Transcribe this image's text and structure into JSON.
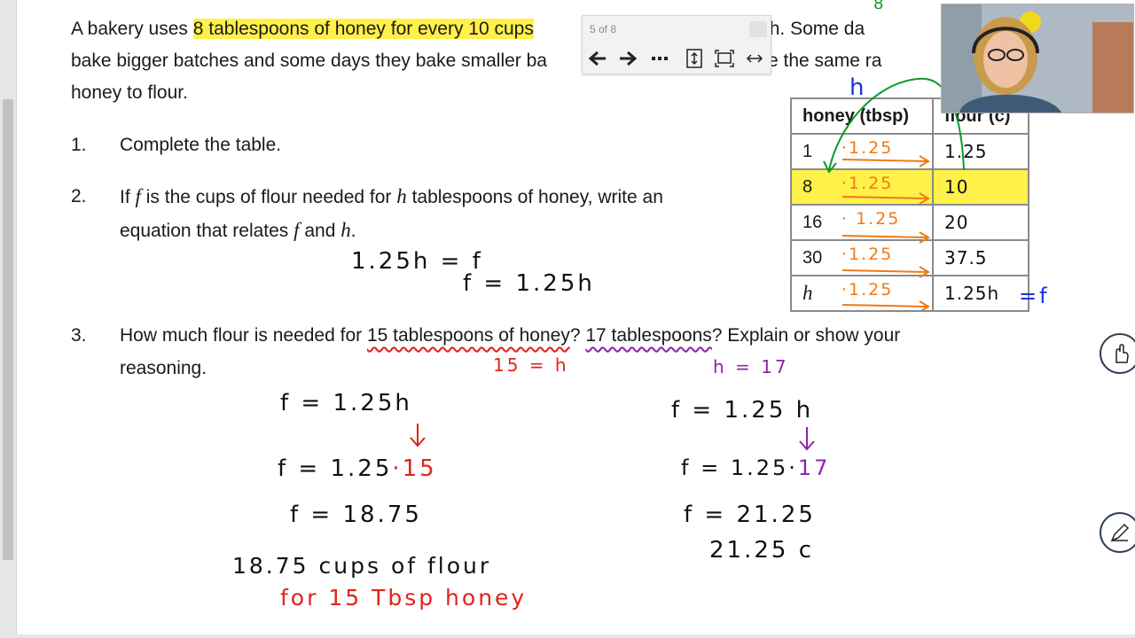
{
  "problem": {
    "intro_line1_pre": "A bakery uses ",
    "intro_line1_hl": "8 tablespoons of honey for every 10 cups",
    "intro_line1_post": "ad dough. Some da",
    "intro_line2_pre": "bake bigger batches and some days they bake smaller ba",
    "intro_line2_post": "ys use the same ra",
    "intro_line3": "honey to flour."
  },
  "questions": [
    {
      "num": "1.",
      "text": "Complete the table."
    },
    {
      "num": "2.",
      "line1_a": "If ",
      "line1_f": "f",
      "line1_b": " is the cups of flour needed for ",
      "line1_h": "h",
      "line1_c": " tablespoons of honey, write an",
      "line2_a": "equation that relates ",
      "line2_f": "f",
      "line2_b": " and ",
      "line2_h": "h",
      "line2_c": "."
    },
    {
      "num": "3.",
      "a": "How much flour is needed for ",
      "u1": "15 tablespoons of honey",
      "b": "? ",
      "u2": "17 tablespoons",
      "c": "? Explain or show your",
      "line2": "reasoning."
    }
  ],
  "table": {
    "header": [
      "honey (tbsp)",
      "flour (c)"
    ],
    "rows": [
      {
        "honey": "1",
        "mult": "·1.25",
        "flour": "1.25",
        "highlight": false
      },
      {
        "honey": "8",
        "mult": "·1.25",
        "flour": "10",
        "highlight": true
      },
      {
        "honey": "16",
        "mult": "· 1.25",
        "flour": "20",
        "highlight": false
      },
      {
        "honey": "30",
        "mult": "·1.25",
        "flour": "37.5",
        "highlight": false
      },
      {
        "honey": "h",
        "mult": "·1.25",
        "flour": "1.25h",
        "highlight": false
      }
    ],
    "flour_suffix": "=f",
    "h_annotation": "h",
    "top_annotation": "8"
  },
  "handwriting": {
    "q2_eq1": "1.25h = f",
    "q2_eq2": "f = 1.25h",
    "q3_left_label": "15 = h",
    "q3_right_label": "h = 17",
    "left_eq1": "f = 1.25h",
    "left_eq2_a": "f = 1.25",
    "left_eq2_b": "·15",
    "left_eq3": "f = 18.75",
    "left_answer1": "18.75 cups of flour",
    "left_answer2": "for 15 Tbsp honey",
    "right_eq1": "f = 1.25 h",
    "right_eq2_a": "f = 1.25·",
    "right_eq2_b": "17",
    "right_eq3": "f = 21.25",
    "right_answer": "21.25 c"
  },
  "pdf_toolbar": {
    "page_indicator": "5 of 8",
    "buttons": [
      "previous-page",
      "next-page",
      "more-options",
      "page-fit",
      "fullscreen",
      "fit-width"
    ]
  },
  "colors": {
    "highlight": "#fff04a",
    "red_ink": "#e0231b",
    "orange_ink": "#f07a12",
    "purple_ink": "#8e24aa",
    "blue_ink": "#1a2fe0",
    "green_ink": "#0c9a2a"
  }
}
